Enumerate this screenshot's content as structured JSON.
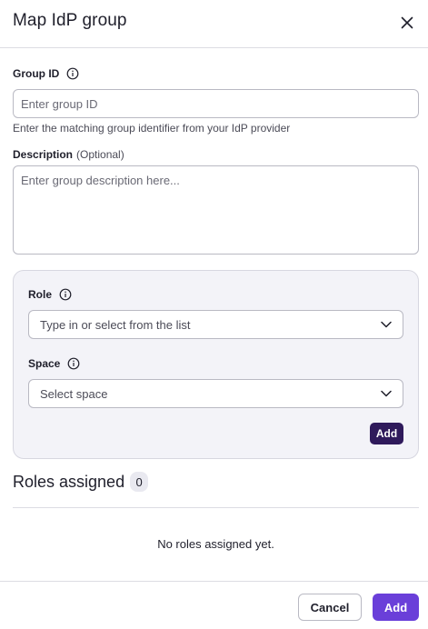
{
  "dialog": {
    "title": "Map IdP group",
    "close_icon": "close-icon"
  },
  "form": {
    "group_id": {
      "label": "Group ID",
      "placeholder": "Enter group ID",
      "value": "",
      "helper": "Enter the matching group identifier from your IdP provider",
      "info_icon": "info-icon"
    },
    "description": {
      "label": "Description",
      "optional_label": "(Optional)",
      "placeholder": "Enter group description here...",
      "value": ""
    }
  },
  "role_section": {
    "role": {
      "label": "Role",
      "placeholder": "Type in or select from the list",
      "info_icon": "info-icon",
      "dropdown_icon": "chevron-down-icon"
    },
    "space": {
      "label": "Space",
      "placeholder": "Select space",
      "info_icon": "info-icon",
      "dropdown_icon": "chevron-down-icon"
    },
    "add_label": "Add"
  },
  "roles_assigned": {
    "title": "Roles assigned",
    "count": "0",
    "empty_message": "No roles assigned yet."
  },
  "footer": {
    "cancel_label": "Cancel",
    "submit_label": "Add"
  },
  "colors": {
    "primary": "#6a3fd9",
    "primary_dark": "#2f1a5b",
    "card_background": "#f3f3f8",
    "border": "#b9b9c3"
  }
}
